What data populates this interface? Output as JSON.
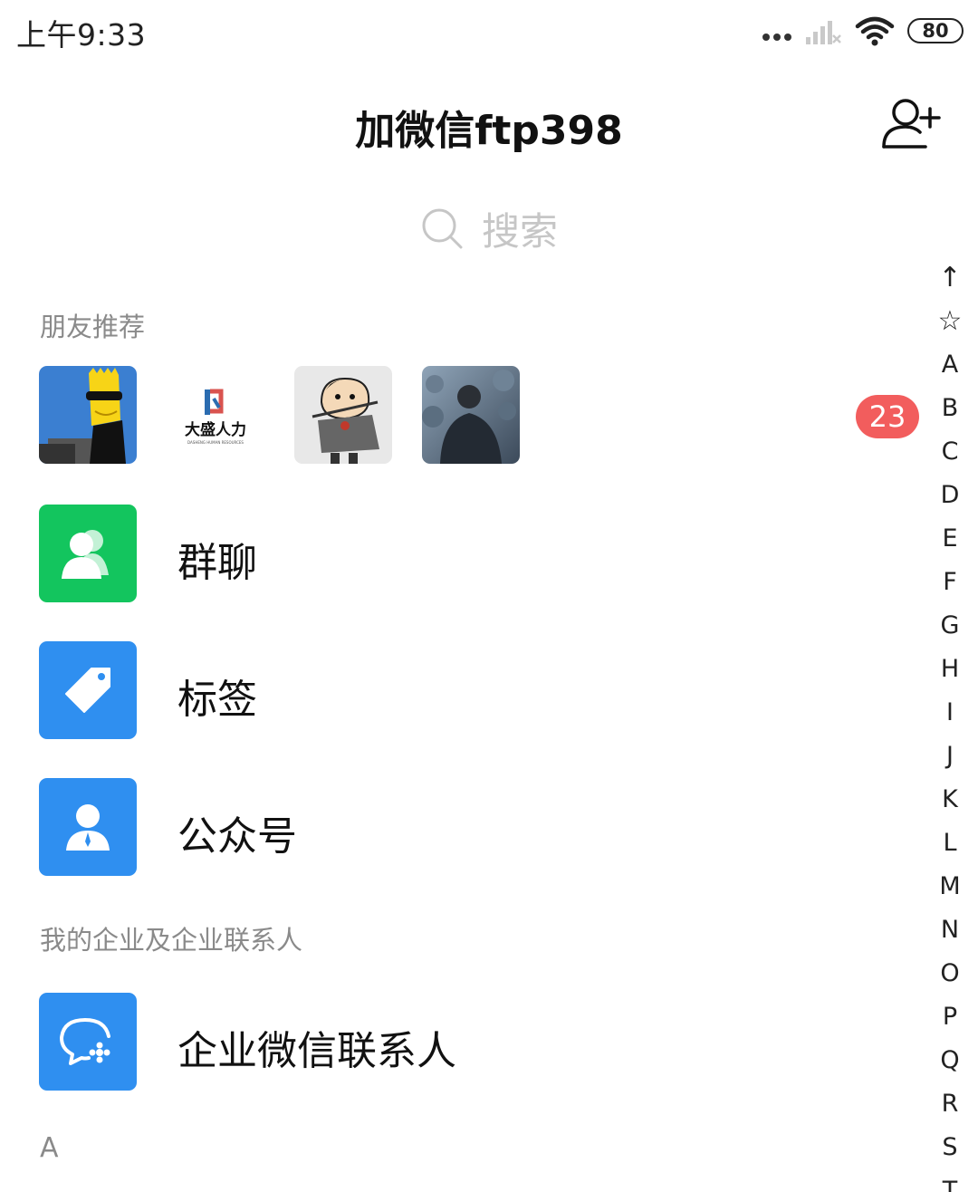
{
  "status_bar": {
    "time": "上午9:33",
    "battery": "80"
  },
  "nav": {
    "title": "加微信ftp398",
    "add_contact_icon": "add-contact-icon"
  },
  "search": {
    "label": "搜索"
  },
  "friend_recommend": {
    "header": "朋友推荐",
    "badge_count": "23",
    "avatars": [
      {
        "name": "cartoon-avatar-1"
      },
      {
        "name": "logo-avatar",
        "logo_text": "大盛人力",
        "logo_subtext": "DASHENG HUMAN RESOURCES"
      },
      {
        "name": "cartoon-avatar-2"
      },
      {
        "name": "photo-avatar"
      }
    ]
  },
  "menu": {
    "group_chat": "群聊",
    "tags": "标签",
    "official_accounts": "公众号"
  },
  "enterprise": {
    "header": "我的企业及企业联系人",
    "contacts": "企业微信联系人"
  },
  "letter_header": "A",
  "index": [
    "↑",
    "☆",
    "A",
    "B",
    "C",
    "D",
    "E",
    "F",
    "G",
    "H",
    "I",
    "J",
    "K",
    "L",
    "M",
    "N",
    "O",
    "P",
    "Q",
    "R",
    "S",
    "T"
  ],
  "colors": {
    "green_icon": "#13c55e",
    "blue_icon": "#2f8ff0",
    "badge": "#f25d5d"
  }
}
